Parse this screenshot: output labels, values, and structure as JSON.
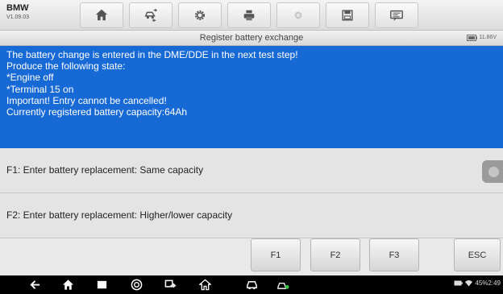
{
  "app": {
    "name": "BMW",
    "version": "V1.09.03"
  },
  "toolbar": {
    "tools": [
      {
        "icon": "home-icon"
      },
      {
        "icon": "vehicle-swap-icon"
      },
      {
        "icon": "settings-gear-icon"
      },
      {
        "icon": "print-icon"
      },
      {
        "icon": "help-icon"
      },
      {
        "icon": "save-icon"
      },
      {
        "icon": "data-logging-icon"
      }
    ]
  },
  "header": {
    "title": "Register battery exchange",
    "battery_voltage": "11.86V"
  },
  "message": {
    "lines": [
      "The battery change is entered in the DME/DDE in the next test step!",
      "Produce the following state:",
      "*Engine off",
      "*Terminal 15 on",
      "Important! Entry cannot be cancelled!",
      "Currently registered battery capacity:64Ah"
    ]
  },
  "options": [
    {
      "label": "F1: Enter battery replacement: Same capacity"
    },
    {
      "label": "F2: Enter battery replacement: Higher/lower capacity"
    }
  ],
  "function_keys": {
    "f1": "F1",
    "f2": "F2",
    "f3": "F3",
    "esc": "ESC"
  },
  "navbar": {
    "icons": [
      "back-icon",
      "home-icon",
      "recent-apps-icon",
      "browser-icon",
      "screen-switch-icon",
      "diagnostics-home-icon",
      "car-icon",
      "vci-connection-icon"
    ],
    "status_text": "45%2:49"
  },
  "colors": {
    "message_bg": "#1769d6",
    "message_text": "#ffffff",
    "option_bg": "#e4e4e4",
    "navbar_bg": "#000000"
  }
}
